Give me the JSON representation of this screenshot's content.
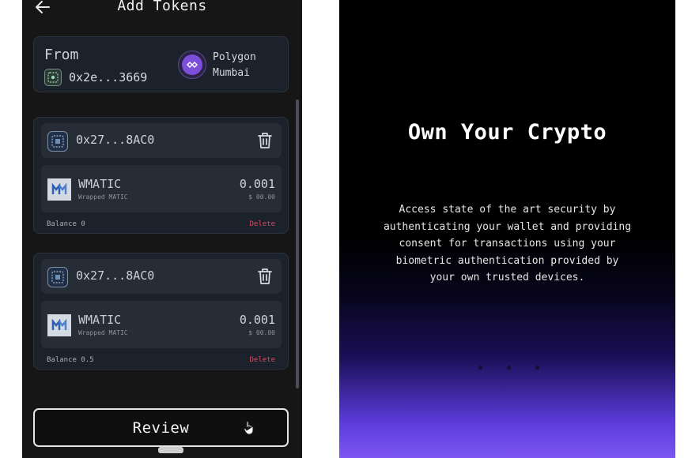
{
  "left_screen": {
    "header": {
      "title": "Add Tokens",
      "back_icon": "arrow-left-icon"
    },
    "from_card": {
      "label": "From",
      "address": "0x2e...3669",
      "wallet_icon": "wallet-icon",
      "network": {
        "name_line1": "Polygon",
        "name_line2": "Mumbai",
        "icon": "polygon-icon",
        "color": "#7d4fd8"
      }
    },
    "tokens": [
      {
        "contract_address": "0x27...8AC0",
        "symbol": "WMATIC",
        "name": "Wrapped MATIC",
        "amount": "0.001",
        "value": "$ 00.00",
        "balance": "Balance 0",
        "delete_label": "Delete"
      },
      {
        "contract_address": "0x27...8AC0",
        "symbol": "WMATIC",
        "name": "Wrapped MATIC",
        "amount": "0.001",
        "value": "$ 00.00",
        "balance": "Balance 0.5",
        "delete_label": "Delete"
      }
    ],
    "review_button": {
      "label": "Review"
    },
    "colors": {
      "delete": "#d9485f",
      "background": "#161616"
    }
  },
  "right_screen": {
    "title": "Own Your Crypto",
    "body": "Access state of the art security by\nauthenticating your wallet and providing\nconsent for transactions using your\nbiometric authentication provided by\nyour own trusted devices.",
    "colors": {
      "gradient_start": "#000000",
      "gradient_end": "#7c55f2"
    }
  }
}
